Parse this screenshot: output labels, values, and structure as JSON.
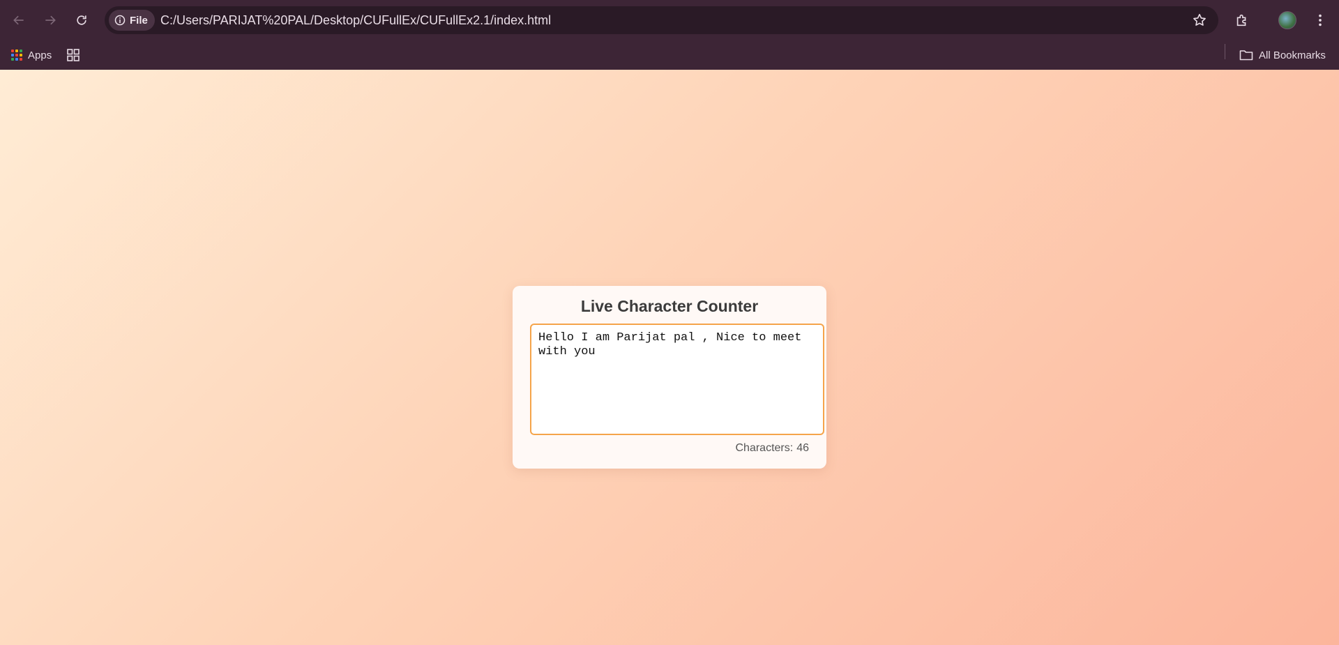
{
  "browser": {
    "site_chip_label": "File",
    "url": "C:/Users/PARIJAT%20PAL/Desktop/CUFullEx/CUFullEx2.1/index.html",
    "bookmarks": {
      "apps_label": "Apps",
      "all_bookmarks_label": "All Bookmarks"
    }
  },
  "page": {
    "title": "Live Character Counter",
    "textarea_value": "Hello I am Parijat pal , Nice to meet with you",
    "counter_label": "Characters:",
    "counter_value": "46"
  },
  "colors": {
    "accent_border": "#f5a44a",
    "chrome_bg": "#3d2536",
    "background_gradient": [
      "#ffecd5",
      "#fed3b7",
      "#fcb59c"
    ]
  },
  "icons": [
    "back-arrow-icon",
    "forward-arrow-icon",
    "reload-icon",
    "info-icon",
    "star-icon",
    "extensions-icon",
    "profile-avatar",
    "kebab-menu-icon",
    "apps-grid-icon",
    "tab-groups-icon",
    "folder-icon"
  ]
}
